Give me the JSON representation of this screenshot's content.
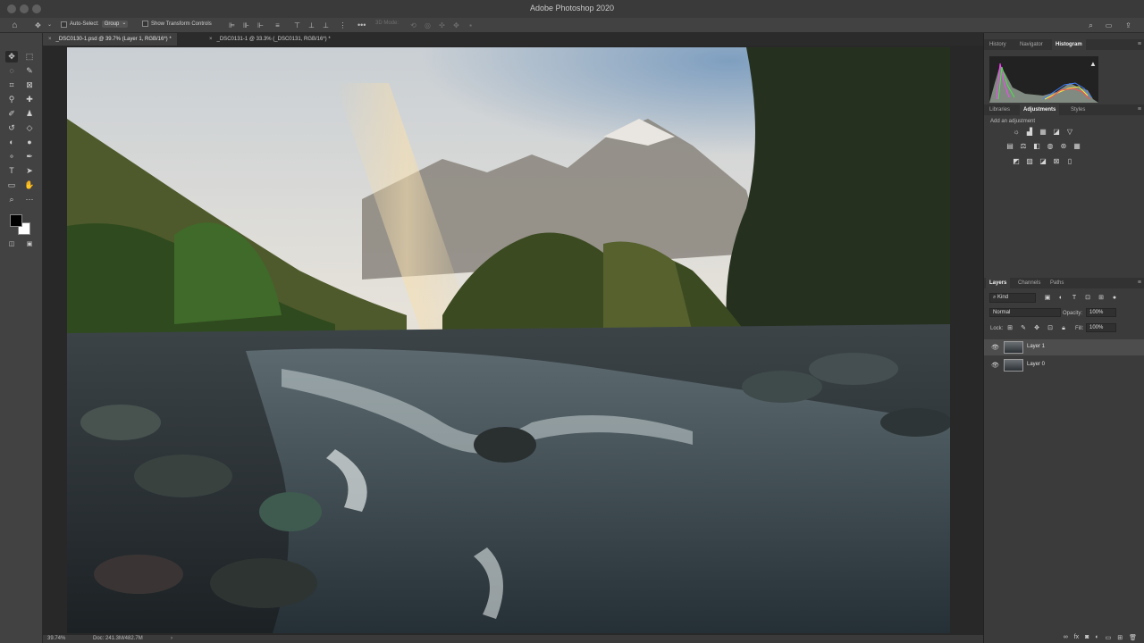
{
  "window": {
    "title": "Adobe Photoshop 2020"
  },
  "options_bar": {
    "auto_select_label": "Auto-Select:",
    "auto_select_value": "Group",
    "show_transform_label": "Show Transform Controls",
    "mode_3d_label": "3D Mode:"
  },
  "tabs": [
    {
      "label": "_DSC0130-1.psd @ 39.7% (Layer 1, RGB/16*) *",
      "active": true
    },
    {
      "label": "_DSC0131-1 @ 33.3% (_DSC0131, RGB/16*) *",
      "active": false
    }
  ],
  "status": {
    "zoom": "39.74%",
    "doc": "Doc: 241.3M/482.7M"
  },
  "panels": {
    "top_tabs": [
      "History",
      "Navigator",
      "Histogram"
    ],
    "top_active": "Histogram",
    "mid_tabs": [
      "Libraries",
      "Adjustments",
      "Styles"
    ],
    "mid_active": "Adjustments",
    "add_adjustment": "Add an adjustment",
    "layer_tabs": [
      "Layers",
      "Channels",
      "Paths"
    ],
    "layers_active": "Layers",
    "filter_kind": "Kind",
    "blend_mode": "Normal",
    "opacity_label": "Opacity:",
    "opacity_value": "100%",
    "lock_label": "Lock:",
    "fill_label": "Fill:",
    "fill_value": "100%",
    "layers": [
      {
        "name": "Layer 1",
        "selected": true,
        "visible": true
      },
      {
        "name": "Layer 0",
        "selected": false,
        "visible": true
      }
    ]
  },
  "colors": {
    "foreground": "#000000",
    "background": "#ffffff",
    "accent_histogram": "#7ad07a"
  }
}
